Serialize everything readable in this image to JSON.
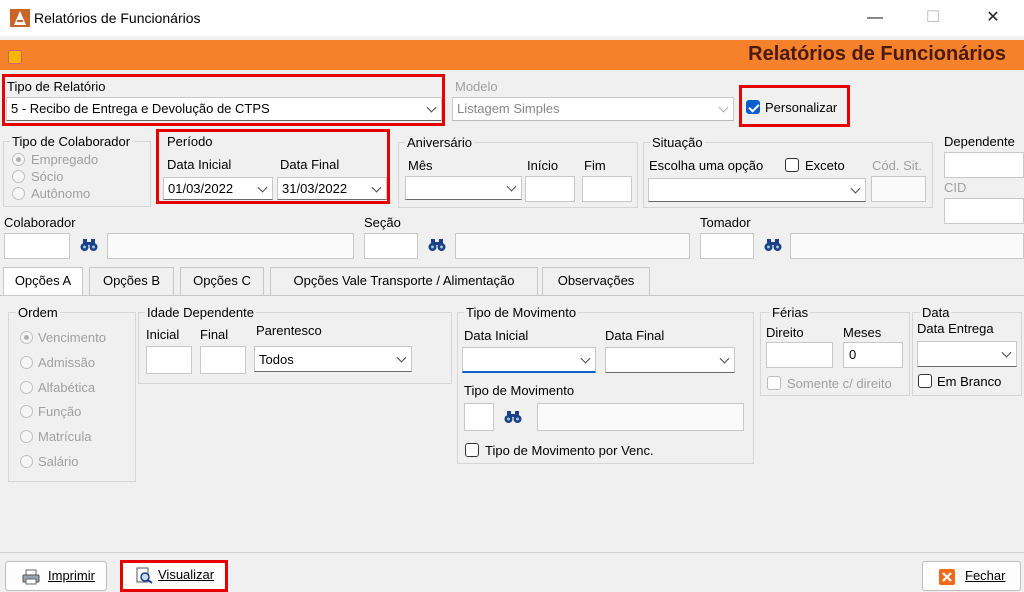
{
  "window": {
    "title": "Relatórios de Funcionários",
    "minimize": "—",
    "maximize": "☐",
    "close": "✕"
  },
  "banner": {
    "title": "Relatórios de Funcionários",
    "icon": "warning-icon"
  },
  "tipo_relatorio": {
    "label": "Tipo de Relatório",
    "value": "5 - Recibo de Entrega e Devolução de CTPS"
  },
  "modelo": {
    "label": "Modelo",
    "value": "Listagem Simples"
  },
  "personalizar": {
    "label": "Personalizar",
    "checked": true
  },
  "tipo_colaborador": {
    "label": "Tipo de Colaborador",
    "options": [
      "Empregado",
      "Sócio",
      "Autônomo"
    ],
    "selected": "Empregado"
  },
  "periodo": {
    "label": "Período",
    "inicial_label": "Data Inicial",
    "inicial_value": "01/03/2022",
    "final_label": "Data Final",
    "final_value": "31/03/2022"
  },
  "aniversario": {
    "label": "Aniversário",
    "mes_label": "Mês",
    "inicio_label": "Início",
    "fim_label": "Fim"
  },
  "situacao": {
    "label": "Situação",
    "choose_label": "Escolha uma opção",
    "exceto_label": "Exceto",
    "cod_sit_label": "Cód. Sit."
  },
  "dependente": {
    "label": "Dependente",
    "cid_label": "CID"
  },
  "colaborador": {
    "label": "Colaborador"
  },
  "secao": {
    "label": "Seção"
  },
  "tomador": {
    "label": "Tomador"
  },
  "tabs": [
    "Opções A",
    "Opções B",
    "Opções C",
    "Opções Vale Transporte  / Alimentação",
    "Observações"
  ],
  "ordem": {
    "label": "Ordem",
    "options": [
      "Vencimento",
      "Admissão",
      "Alfabética",
      "Função",
      "Matrícula",
      "Salário"
    ],
    "selected": "Vencimento"
  },
  "idade_dependente": {
    "label": "Idade Dependente",
    "inicial_label": "Inicial",
    "final_label": "Final",
    "parentesco_label": "Parentesco",
    "parentesco_value": "Todos"
  },
  "tipo_movimento": {
    "label": "Tipo de Movimento",
    "data_inicial_label": "Data Inicial",
    "data_final_label": "Data Final",
    "tipo_label": "Tipo de Movimento",
    "por_venc_label": "Tipo de Movimento por Venc."
  },
  "ferias": {
    "label": "Férias",
    "direito_label": "Direito",
    "meses_label": "Meses",
    "meses_value": "0",
    "somente_label": "Somente c/ direito"
  },
  "data_group": {
    "label": "Data",
    "entrega_label": "Data Entrega",
    "em_branco_label": "Em Branco"
  },
  "buttons": {
    "imprimir": "Imprimir",
    "visualizar": "Visualizar",
    "fechar": "Fechar"
  }
}
